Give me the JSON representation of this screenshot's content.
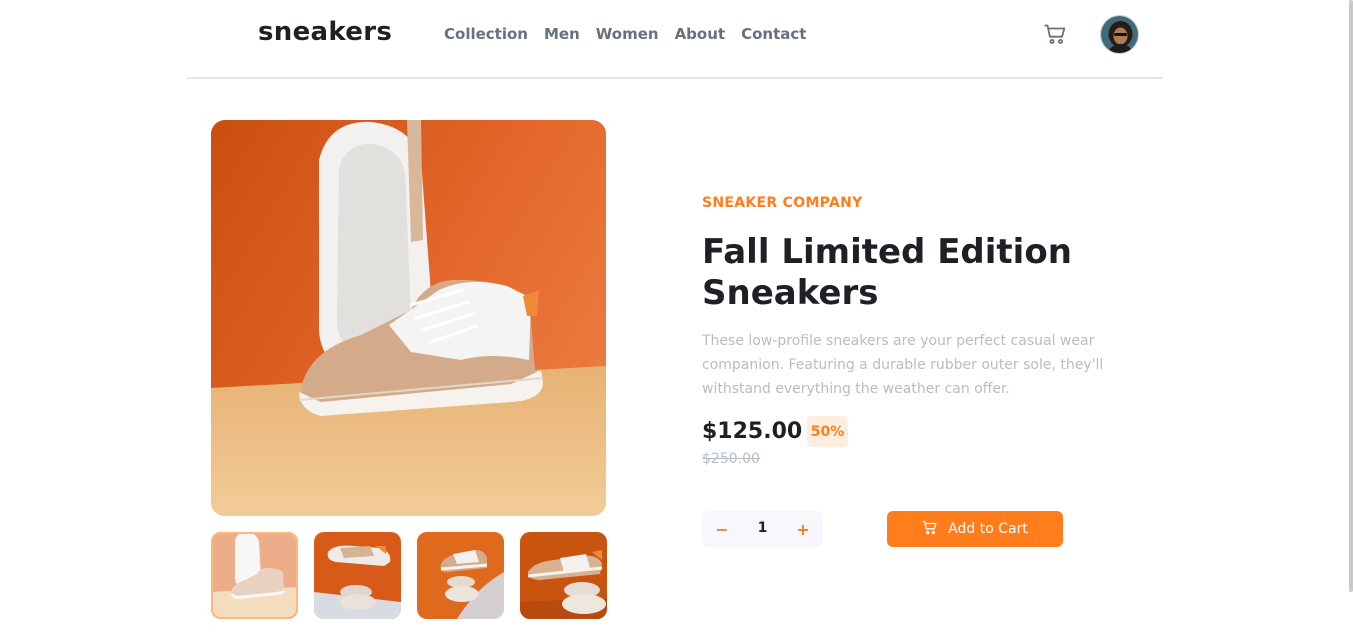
{
  "header": {
    "logo": "sneakers",
    "nav": [
      "Collection",
      "Men",
      "Women",
      "About",
      "Contact"
    ],
    "cart_icon": "cart-icon",
    "avatar": "user-avatar"
  },
  "product": {
    "company": "SNEAKER COMPANY",
    "title_line1": "Fall Limited Edition",
    "title_line2": "Sneakers",
    "description": "These low-profile sneakers are your perfect casual wear companion. Featuring a durable rubber outer sole, they'll withstand everything the weather can offer.",
    "price": "$125.00",
    "discount": "50%",
    "old_price": "$250.00"
  },
  "cart_controls": {
    "minus": "−",
    "quantity": "1",
    "plus": "+",
    "add_label": "Add to Cart"
  },
  "gallery": {
    "thumbnail_count": 4,
    "active_thumbnail": 1
  },
  "colors": {
    "accent": "#ff7d1a",
    "accent_pale": "#ffede0",
    "text_dark": "#1d2025",
    "text_grey": "#68707d",
    "text_light": "#b6bcc8"
  }
}
